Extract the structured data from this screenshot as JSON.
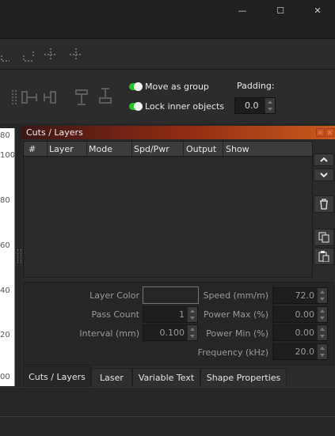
{
  "window": {
    "minimize_glyph": "—",
    "maximize_glyph": "☐",
    "close_glyph": "✕"
  },
  "toolbar2": {
    "move_as_group": "Move as group",
    "lock_inner_objects": "Lock inner objects",
    "padding_label": "Padding:",
    "padding_value": "0.0"
  },
  "ruler": {
    "ticks": [
      "80",
      "100",
      "80",
      "60",
      "40",
      "20",
      "00"
    ]
  },
  "panel": {
    "title": "Cuts / Layers",
    "columns": [
      "#",
      "Layer",
      "Mode",
      "Spd/Pwr",
      "Output",
      "Show"
    ],
    "properties": {
      "layer_color_label": "Layer Color",
      "pass_count_label": "Pass Count",
      "pass_count_value": "1",
      "interval_label": "Interval (mm)",
      "interval_value": "0.100",
      "speed_label": "Speed (mm/m)",
      "speed_value": "72.0",
      "power_max_label": "Power Max (%)",
      "power_max_value": "0.00",
      "power_min_label": "Power Min (%)",
      "power_min_value": "0.00",
      "frequency_label": "Frequency (kHz)",
      "frequency_value": "20.0"
    },
    "tabs": [
      "Cuts / Layers",
      "Laser",
      "Variable Text",
      "Shape Properties"
    ]
  }
}
